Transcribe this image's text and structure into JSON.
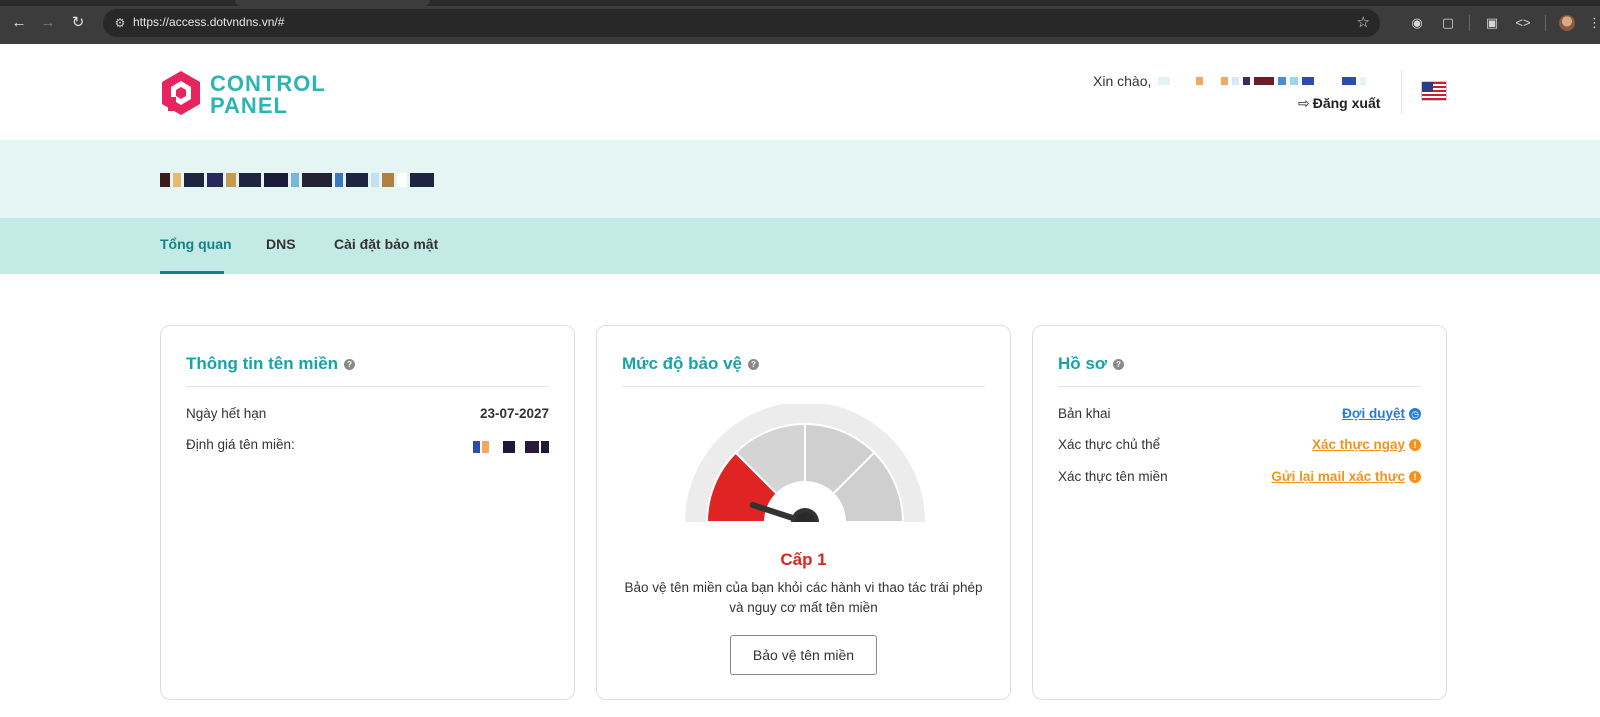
{
  "browser": {
    "url": "https://access.dotvndns.vn/#"
  },
  "header": {
    "logo_line1": "CONTROL",
    "logo_line2": "PANEL",
    "greeting": "Xin chào,",
    "logout_label": "Đăng xuất"
  },
  "tabs": [
    {
      "label": "Tổng quan",
      "active": true
    },
    {
      "label": "DNS",
      "active": false
    },
    {
      "label": "Cài đặt bảo mật",
      "active": false
    }
  ],
  "domain_info": {
    "title": "Thông tin tên miền",
    "expiry_label": "Ngày hết hạn",
    "expiry_value": "23-07-2027",
    "valuation_label": "Định giá tên miền:"
  },
  "protection": {
    "title": "Mức độ bảo vệ",
    "level_label": "Cấp 1",
    "level": 1,
    "level_max": 4,
    "description": "Bảo vệ tên miền của bạn khỏi các hành vi thao tác trái phép và nguy cơ mất tên miền",
    "button_label": "Bảo vệ tên miền",
    "active_color": "#e02424"
  },
  "profile": {
    "title": "Hồ sơ",
    "rows": [
      {
        "label": "Bản khai",
        "status": "Đợi duyệt",
        "color": "#2a7bd6",
        "icon": "clock-icon"
      },
      {
        "label": "Xác thực chủ thể",
        "status": "Xác thực ngay",
        "color": "#f0941c",
        "icon": "exclamation-icon"
      },
      {
        "label": "Xác thực tên miền",
        "status": "Gửi lại mail xác thực",
        "color": "#f0941c",
        "icon": "exclamation-icon"
      }
    ]
  },
  "colors": {
    "accent": "#18a3a9",
    "tab_active": "#14828a",
    "band": "#e4f5f3",
    "tabbar": "#c3eae4"
  }
}
